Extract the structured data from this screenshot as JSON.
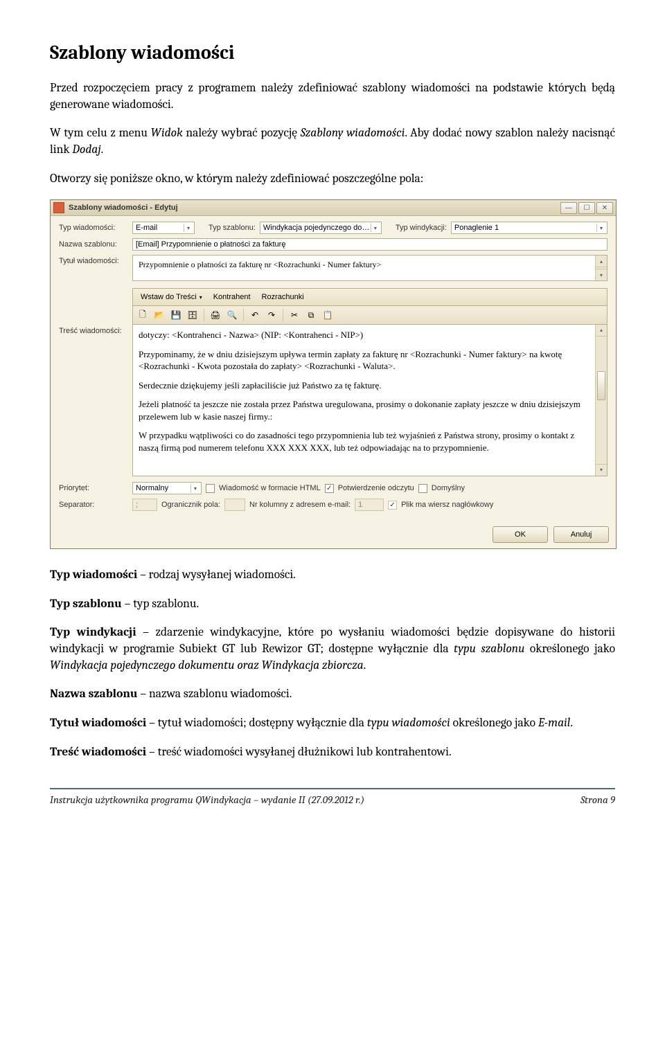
{
  "doc": {
    "h1": "Szablony wiadomości",
    "p1": "Przed rozpoczęciem pracy z programem należy zdefiniować szablony wiadomości na podstawie których będą generowane wiadomości.",
    "p2_a": "W tym celu z menu ",
    "p2_b": "Widok",
    "p2_c": " należy wybrać pozycję ",
    "p2_d": "Szablony wiadomości",
    "p2_e": ". Aby dodać nowy szablon należy nacisnąć link ",
    "p2_f": "Dodaj",
    "p2_g": ".",
    "p3": "Otworzy się poniższe okno, w którym należy zdefiniować poszczególne pola:",
    "typ_wiad_l": "Typ wiadomości",
    "typ_wiad_r": " – rodzaj wysyłanej wiadomości.",
    "typ_szab_l": "Typ szablonu",
    "typ_szab_r": " – typ szablonu.",
    "typ_wind_l": "Typ windykacji",
    "typ_wind_r": " – zdarzenie windykacyjne, które po wysłaniu wiadomości będzie dopisywane do historii windykacji w programie Subiekt GT lub Rewizor GT; dostępne wyłącznie dla ",
    "typ_wind_i1": "typu szablonu",
    "typ_wind_r2": " określonego jako ",
    "typ_wind_i2": "Windykacja pojedynczego dokumentu oraz Windykacja zbiorcza",
    "typ_wind_r3": ".",
    "nazwa_l": "Nazwa szablonu",
    "nazwa_r": " – nazwa szablonu wiadomości.",
    "tytul_l": "Tytuł wiadomości",
    "tytul_r1": " – tytuł wiadomości; dostępny wyłącznie dla ",
    "tytul_i": "typu wiadomości",
    "tytul_r2": " określonego jako ",
    "tytul_i2": "E-mail",
    "tytul_r3": ".",
    "tresc_l": "Treść wiadomości",
    "tresc_r": " – treść wiadomości wysyłanej dłużnikowi lub kontrahentowi."
  },
  "win": {
    "title": "Szablony wiadomości - Edytuj",
    "labels": {
      "typ_wiad": "Typ wiadomości:",
      "typ_szab": "Typ szablonu:",
      "typ_wind": "Typ windykacji:",
      "nazwa": "Nazwa szablonu:",
      "tytul": "Tytuł wiadomości:",
      "tresc": "Treść wiadomości:",
      "priorytet": "Priorytet:",
      "separator": "Separator:",
      "ogranicznik": "Ogranicznik pola:",
      "nrkol": "Nr kolumny z adresem e-mail:"
    },
    "values": {
      "typ_wiad": "E-mail",
      "typ_szab": "Windykacja pojedynczego do…",
      "typ_wind": "Ponaglenie 1",
      "nazwa": "[Email] Przypomnienie o płatności za fakturę",
      "tytul": "Przypomnienie o płatności za fakturę nr <Rozrachunki - Numer faktury>",
      "priorytet": "Normalny",
      "separator": ";",
      "nrkol": "1"
    },
    "toolbar": {
      "wstaw": "Wstaw do Treści",
      "kontrahent": "Kontrahent",
      "rozrachunki": "Rozrachunki"
    },
    "body": {
      "l1": "dotyczy: <Kontrahenci - Nazwa> (NIP: <Kontrahenci - NIP>)",
      "l2": "Przypominamy, że w dniu dzisiejszym upływa termin zapłaty za fakturę nr <Rozrachunki - Numer faktury> na kwotę <Rozrachunki - Kwota pozostała do zapłaty> <Rozrachunki - Waluta>.",
      "l3": "Serdecznie dziękujemy jeśli zapłaciliście już Państwo za tę fakturę.",
      "l4": "Jeżeli płatność ta jeszcze nie została przez Państwa uregulowana, prosimy o dokonanie zapłaty jeszcze w dniu dzisiejszym przelewem lub w kasie naszej firmy.:",
      "l5": "W przypadku wątpliwości co do zasadności tego przypomnienia lub też wyjaśnień z Państwa strony, prosimy o kontakt z naszą firmą pod numerem telefonu XXX XXX XXX, lub też odpowiadając na to przypomnienie."
    },
    "checks": {
      "html": "Wiadomość w formacie HTML",
      "potw": "Potwierdzenie odczytu",
      "domyslny": "Domyślny",
      "plik": "Plik ma wiersz nagłówkowy"
    },
    "buttons": {
      "ok": "OK",
      "anuluj": "Anuluj"
    }
  },
  "footer": {
    "left": "Instrukcja użytkownika programu QWindykacja – wydanie II (27.09.2012 r.)",
    "right": "Strona 9"
  }
}
